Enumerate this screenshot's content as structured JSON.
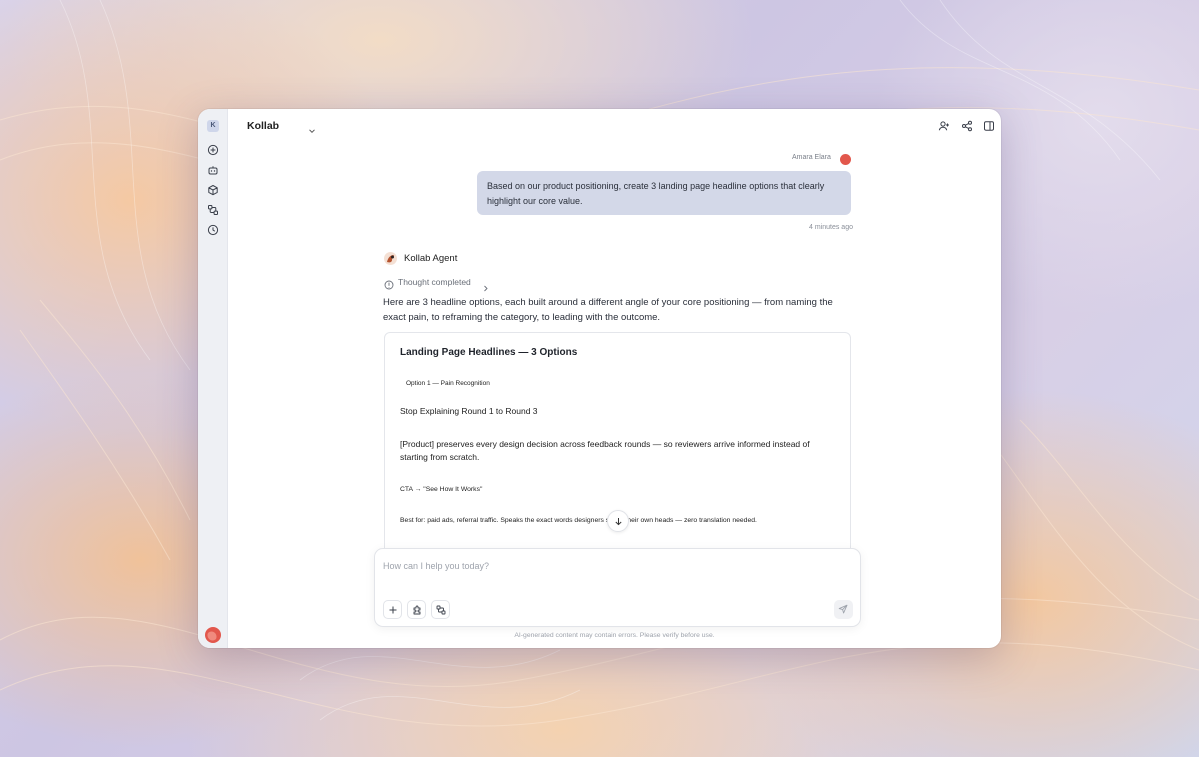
{
  "app": {
    "title": "Kollab",
    "logo_letter": "K"
  },
  "sidebar": {
    "items": [
      {
        "icon": "plus-circle-icon"
      },
      {
        "icon": "bot-icon"
      },
      {
        "icon": "cube-icon"
      },
      {
        "icon": "workflow-icon"
      },
      {
        "icon": "history-icon"
      }
    ]
  },
  "topbar": {
    "actions": [
      "add-user-icon",
      "share-icon",
      "panel-icon"
    ]
  },
  "conversation": {
    "user": {
      "name": "Amara Elara",
      "message": "Based on our product positioning, create 3 landing page headline options that clearly highlight our core value.",
      "time": "4 minutes ago"
    },
    "agent": {
      "name": "Kollab Agent",
      "thought_label": "Thought completed",
      "intro": "Here are 3 headline options, each built around a different angle of your core positioning — from naming the exact pain, to reframing the category, to leading with the outcome.",
      "document": {
        "title": "Landing Page Headlines — 3 Options",
        "option_tag": "Option 1 — Pain Recognition",
        "headline": "Stop Explaining Round 1 to Round 3",
        "description": "[Product] preserves every design decision across feedback rounds — so reviewers arrive informed instead of starting from scratch.",
        "cta": "CTA → \"See How It Works\"",
        "best_for": "Best for: paid ads, referral traffic. Speaks the exact words designers say in their own heads — zero translation needed."
      }
    }
  },
  "composer": {
    "placeholder": "How can I help you today?"
  },
  "footer": {
    "disclaimer": "AI-generated content may contain errors. Please verify before use."
  }
}
